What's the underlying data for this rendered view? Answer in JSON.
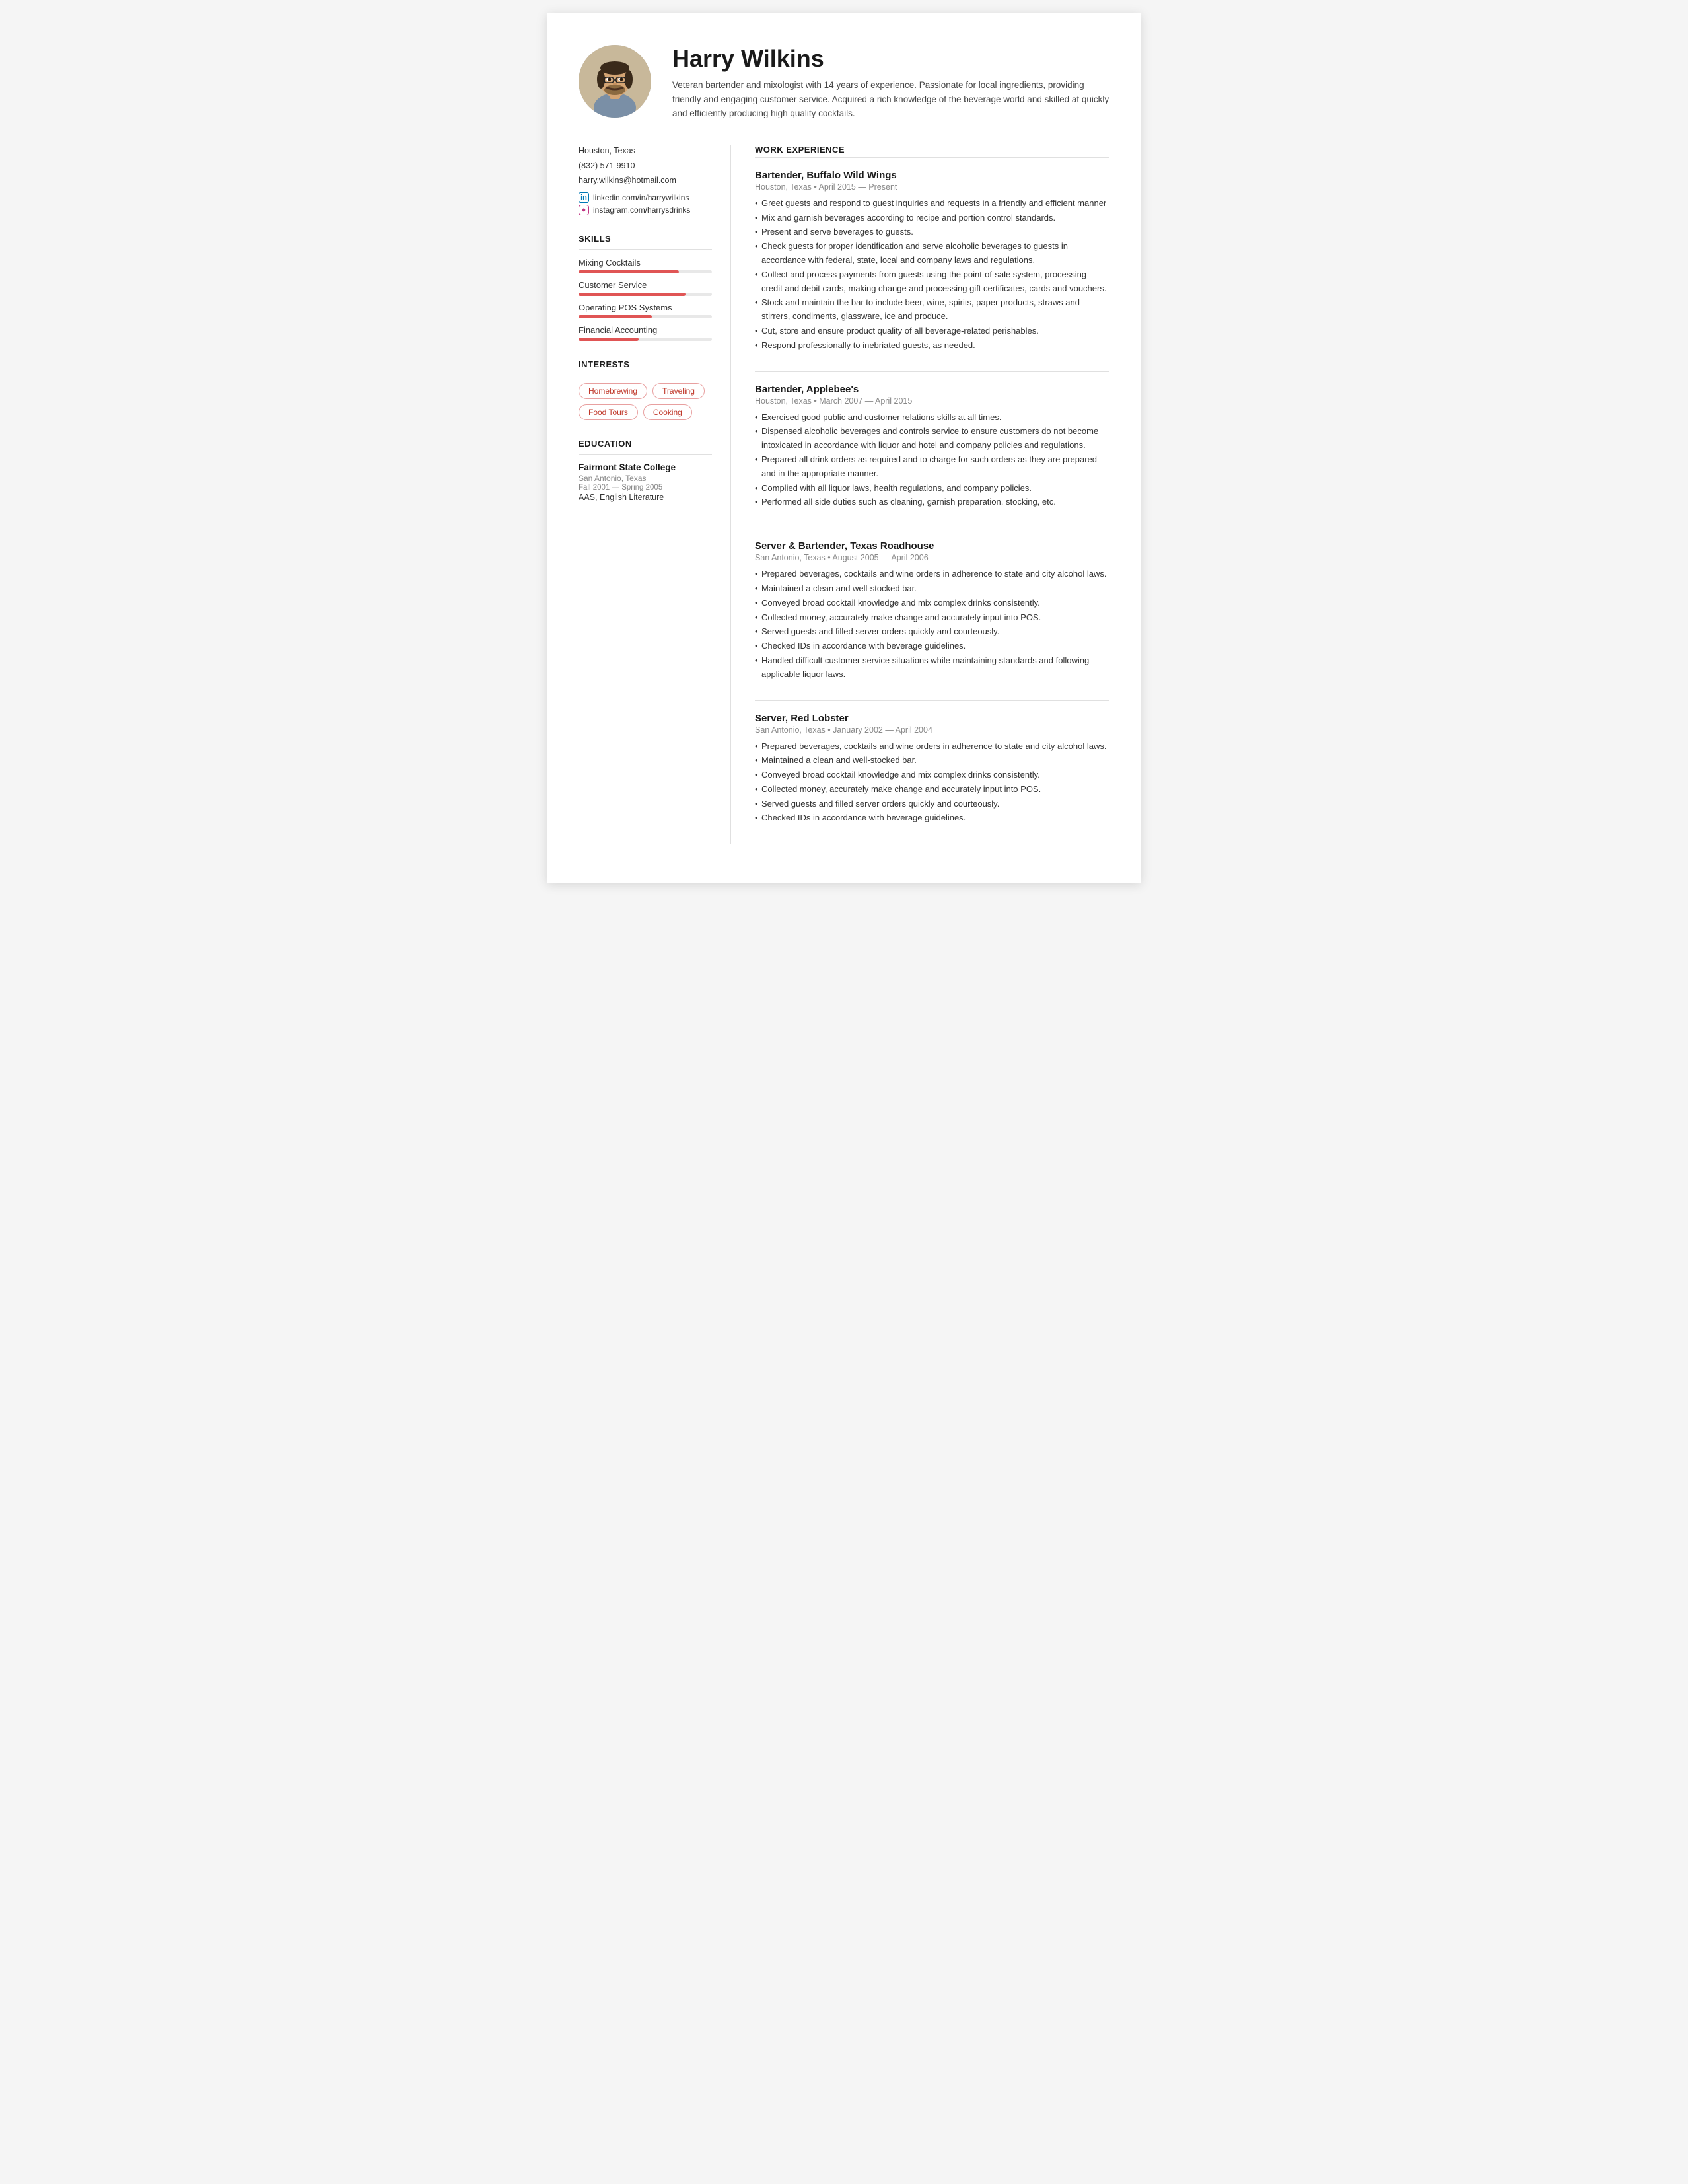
{
  "header": {
    "name": "Harry Wilkins",
    "summary": "Veteran bartender and mixologist with 14 years of experience. Passionate for local ingredients, providing friendly and engaging customer service. Acquired a rich knowledge of the beverage world and skilled at quickly and efficiently producing high quality cocktails.",
    "avatar_alt": "Harry Wilkins photo"
  },
  "contact": {
    "location": "Houston, Texas",
    "phone": "(832) 571-9910",
    "email": "harry.wilkins@hotmail.com",
    "linkedin": "linkedin.com/in/harrywilkins",
    "instagram": "instagram.com/harrysdrinks"
  },
  "skills_title": "SKILLS",
  "skills": [
    {
      "name": "Mixing Cocktails",
      "pct": 75
    },
    {
      "name": "Customer Service",
      "pct": 80
    },
    {
      "name": "Operating POS Systems",
      "pct": 55
    },
    {
      "name": "Financial Accounting",
      "pct": 45
    }
  ],
  "interests_title": "INTERESTS",
  "interests": [
    "Homebrewing",
    "Traveling",
    "Food Tours",
    "Cooking"
  ],
  "education_title": "EDUCATION",
  "education": {
    "school": "Fairmont State College",
    "location": "San Antonio, Texas",
    "dates": "Fall 2001 — Spring 2005",
    "degree": "AAS, English Literature"
  },
  "work_section_title": "WORK EXPERIENCE",
  "jobs": [
    {
      "title": "Bartender, Buffalo Wild Wings",
      "meta": "Houston, Texas • April 2015 — Present",
      "bullets": [
        "Greet guests and respond to guest inquiries and requests in a friendly and efficient manner",
        "Mix and garnish beverages according to recipe and portion control standards.",
        "Present and serve beverages to guests.",
        "Check guests for proper identification and serve alcoholic beverages to guests in accordance with federal, state, local and company laws and regulations.",
        "Collect and process payments from guests using the point-of-sale system, processing credit and debit cards, making change and processing gift certificates, cards and vouchers.",
        "Stock and maintain the bar to include beer, wine, spirits, paper products, straws and stirrers, condiments, glassware, ice and produce.",
        "Cut, store and ensure product quality of all beverage-related perishables.",
        "Respond professionally to inebriated guests, as needed."
      ]
    },
    {
      "title": "Bartender, Applebee's",
      "meta": "Houston, Texas • March 2007 — April 2015",
      "bullets": [
        "Exercised good public and customer relations skills at all times.",
        "Dispensed alcoholic beverages and controls service to ensure customers do not become intoxicated in accordance with liquor and hotel and company policies and regulations.",
        "Prepared all drink orders as required and to charge for such orders as they are prepared and in the appropriate manner.",
        "Complied with all liquor laws, health regulations, and company policies.",
        "Performed all side duties such as cleaning, garnish preparation, stocking, etc."
      ]
    },
    {
      "title": "Server & Bartender, Texas Roadhouse",
      "meta": "San Antonio, Texas • August 2005 — April 2006",
      "bullets": [
        "Prepared beverages, cocktails and wine orders in adherence to state and city alcohol laws.",
        "Maintained a clean and well-stocked bar.",
        "Conveyed broad cocktail knowledge and mix complex drinks consistently.",
        "Collected money, accurately make change and accurately input into POS.",
        "Served guests and filled server orders quickly and courteously.",
        "Checked IDs in accordance with beverage guidelines.",
        "Handled difficult customer service situations while maintaining standards and following applicable liquor laws."
      ]
    },
    {
      "title": "Server, Red Lobster",
      "meta": "San Antonio, Texas • January 2002 — April 2004",
      "bullets": [
        "Prepared beverages, cocktails and wine orders in adherence to state and city alcohol laws.",
        "Maintained a clean and well-stocked bar.",
        "Conveyed broad cocktail knowledge and mix complex drinks consistently.",
        "Collected money, accurately make change and accurately input into POS.",
        "Served guests and filled server orders quickly and courteously.",
        "Checked IDs in accordance with beverage guidelines."
      ]
    }
  ]
}
